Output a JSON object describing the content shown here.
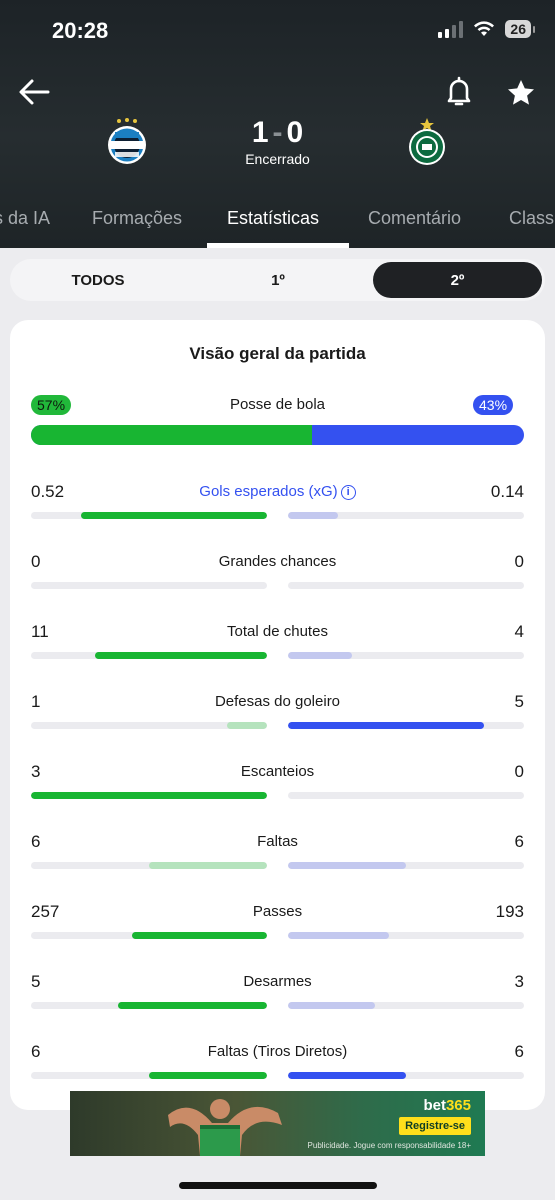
{
  "status_bar": {
    "time": "20:28",
    "battery": "26"
  },
  "match": {
    "home_score": "1",
    "separator": "-",
    "away_score": "0",
    "status": "Encerrado"
  },
  "tabs": [
    {
      "label": "s da IA"
    },
    {
      "label": "Formações"
    },
    {
      "label": "Estatísticas",
      "active": true
    },
    {
      "label": "Comentário"
    },
    {
      "label": "Class"
    }
  ],
  "period_filter": [
    {
      "label": "TODOS"
    },
    {
      "label": "1º"
    },
    {
      "label": "2º",
      "active": true
    }
  ],
  "overview": {
    "title": "Visão geral da partida",
    "possession": {
      "label": "Posse de bola",
      "home": "57%",
      "away": "43%",
      "home_fraction": 0.57
    }
  },
  "stats": [
    {
      "label": "Gols esperados (xG)",
      "home": "0.52",
      "away": "0.14",
      "home_fill": 0.79,
      "away_fill": 0.21,
      "home_strong": true,
      "away_strong": false,
      "link": true
    },
    {
      "label": "Grandes chances",
      "home": "0",
      "away": "0",
      "home_fill": 0,
      "away_fill": 0,
      "home_strong": false,
      "away_strong": false
    },
    {
      "label": "Total de chutes",
      "home": "11",
      "away": "4",
      "home_fill": 0.73,
      "away_fill": 0.27,
      "home_strong": true,
      "away_strong": false
    },
    {
      "label": "Defesas do goleiro",
      "home": "1",
      "away": "5",
      "home_fill": 0.17,
      "away_fill": 0.83,
      "home_strong": false,
      "away_strong": true
    },
    {
      "label": "Escanteios",
      "home": "3",
      "away": "0",
      "home_fill": 1,
      "away_fill": 0,
      "home_strong": true,
      "away_strong": false
    },
    {
      "label": "Faltas",
      "home": "6",
      "away": "6",
      "home_fill": 0.5,
      "away_fill": 0.5,
      "home_strong": false,
      "away_strong": false
    },
    {
      "label": "Passes",
      "home": "257",
      "away": "193",
      "home_fill": 0.57,
      "away_fill": 0.43,
      "home_strong": true,
      "away_strong": false
    },
    {
      "label": "Desarmes",
      "home": "5",
      "away": "3",
      "home_fill": 0.63,
      "away_fill": 0.37,
      "home_strong": true,
      "away_strong": false
    },
    {
      "label": "Faltas (Tiros Diretos)",
      "home": "6",
      "away": "6",
      "home_fill": 0.5,
      "away_fill": 0.5,
      "home_strong": true,
      "away_strong": true
    }
  ],
  "colors": {
    "home_strong": "#18b532",
    "home_weak": "#b5e3bd",
    "away_strong": "#3451f0",
    "away_weak": "#c3c8ef"
  },
  "ad": {
    "brand_prefix": "bet",
    "brand_suffix": "365",
    "cta": "Registre-se",
    "disclaimer": "Publicidade. Jogue com responsabilidade 18+"
  }
}
